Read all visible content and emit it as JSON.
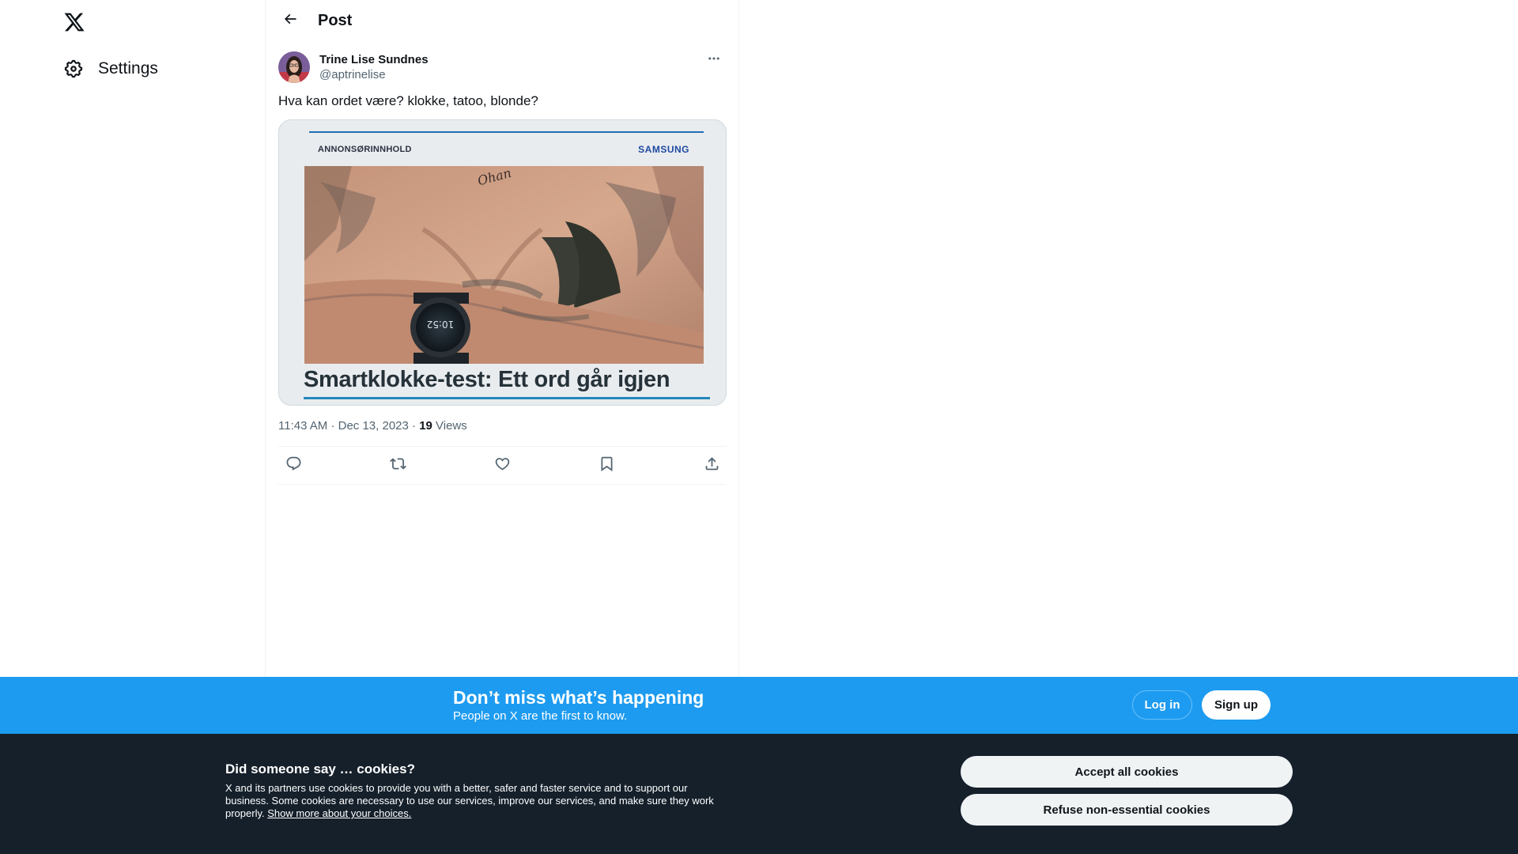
{
  "nav": {
    "logo_icon": "x-logo-icon",
    "settings_label": "Settings",
    "settings_icon": "gear-icon"
  },
  "header": {
    "back_icon": "arrow-left-icon",
    "title": "Post"
  },
  "post": {
    "display_name": "Trine Lise Sundnes",
    "handle": "@aptrinelise",
    "more_icon": "ellipsis-icon",
    "text": "Hva kan ordet være? klokke, tatoo, blonde?",
    "media": {
      "tag_left": "ANNONSØRINNHOLD",
      "tag_right": "SAMSUNG",
      "headline": "Smartklokke-test: Ett ord går igjen",
      "watch_time": "10:52",
      "tattoo_text": "Ohan"
    },
    "time": "11:43 AM",
    "date": "Dec 13, 2023",
    "views_count": "19",
    "views_label": "Views",
    "actions": [
      "reply-icon",
      "repost-icon",
      "like-icon",
      "bookmark-icon",
      "share-icon"
    ]
  },
  "banner": {
    "title": "Don’t miss what’s happening",
    "subtitle": "People on X are the first to know.",
    "login_label": "Log in",
    "signup_label": "Sign up",
    "color": "#1d9bf0"
  },
  "cookie": {
    "title": "Did someone say … cookies?",
    "text": "X and its partners use cookies to provide you with a better, safer and faster service and to support our business. Some cookies are necessary to use our services, improve our services, and make sure they work properly.",
    "link": "Show more about your choices.",
    "accept_label": "Accept all cookies",
    "refuse_label": "Refuse non-essential cookies",
    "background": "#15202b"
  }
}
